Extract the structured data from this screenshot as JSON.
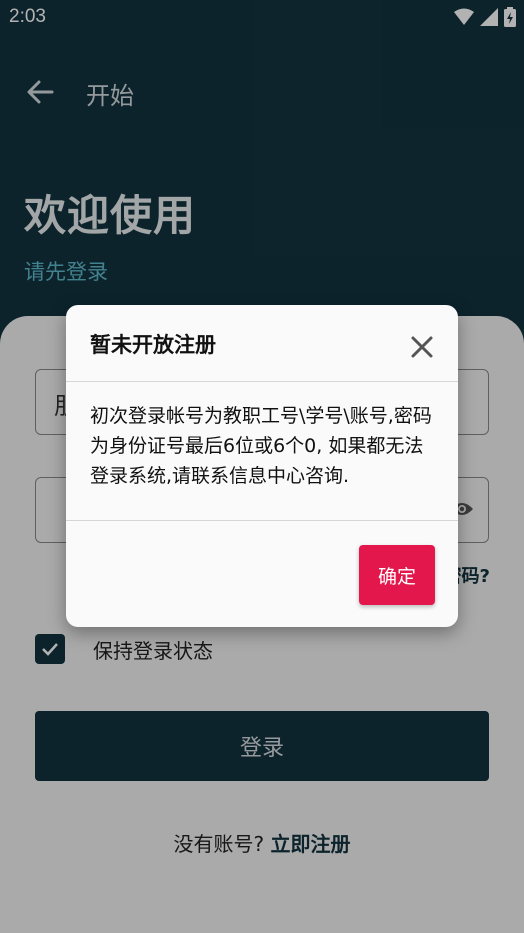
{
  "status_bar": {
    "time": "2:03"
  },
  "app_bar": {
    "title": "开始"
  },
  "hero": {
    "welcome": "欢迎使用",
    "subtitle": "请先登录"
  },
  "form": {
    "username_value": "朋",
    "forgot_text": "密码?",
    "remember_label": "保持登录状态",
    "remember_checked": true,
    "login_button": "登录",
    "no_account_text": "没有账号?",
    "register_link": "立即注册"
  },
  "dialog": {
    "title": "暂未开放注册",
    "message": "初次登录帐号为教职工号\\学号\\账号,密码为身份证号最后6位或6个0, 如果都无法登录系统,请联系信息中心咨询.",
    "confirm_button": "确定"
  },
  "colors": {
    "primary_dark": "#12333f",
    "accent_teal": "#5fb9cc",
    "confirm_red": "#e3174b"
  }
}
